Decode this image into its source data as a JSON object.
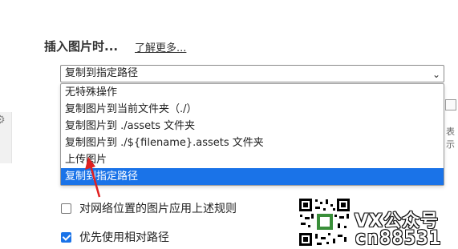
{
  "section": {
    "title": "插入图片时...",
    "learn_more": "了解更多..."
  },
  "select": {
    "value": "复制到指定路径"
  },
  "dropdown": {
    "options": [
      "无特殊操作",
      "复制图片到当前文件夹（./）",
      "复制图片到 ./assets 文件夹",
      "复制图片到 ./${filename}.assets 文件夹",
      "上传图片",
      "复制到指定路径"
    ],
    "selected_index": 5
  },
  "side": {
    "text": "表示"
  },
  "checkboxes": [
    {
      "label": "对网络位置的图片应用上述规则",
      "checked": false
    },
    {
      "label": "优先使用相对路径",
      "checked": true
    }
  ],
  "watermark": {
    "line1": "VX公众号",
    "line2": "cn88531"
  },
  "colors": {
    "accent": "#1a73e8",
    "annotation_arrow": "#e02020"
  },
  "icons": {
    "select_chevron": "chevron-down-icon",
    "annotation": "red-arrow-icon",
    "qr": "qr-code-icon"
  }
}
